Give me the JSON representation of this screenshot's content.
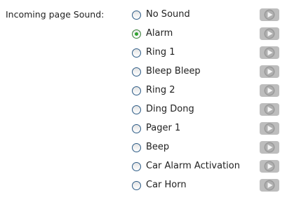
{
  "label": "Incoming page Sound:",
  "colors": {
    "play_button_fill": "#bdbdbd",
    "play_icon_fill": "#f2f2f2",
    "selected_dot": "#2fa32f",
    "radio_border": "#2b5a85"
  },
  "sounds": [
    {
      "name": "No Sound",
      "selected": false
    },
    {
      "name": "Alarm",
      "selected": true
    },
    {
      "name": "Ring 1",
      "selected": false
    },
    {
      "name": "Bleep Bleep",
      "selected": false
    },
    {
      "name": "Ring 2",
      "selected": false
    },
    {
      "name": "Ding Dong",
      "selected": false
    },
    {
      "name": "Pager 1",
      "selected": false
    },
    {
      "name": "Beep",
      "selected": false
    },
    {
      "name": "Car Alarm Activation",
      "selected": false
    },
    {
      "name": "Car Horn",
      "selected": false
    }
  ]
}
